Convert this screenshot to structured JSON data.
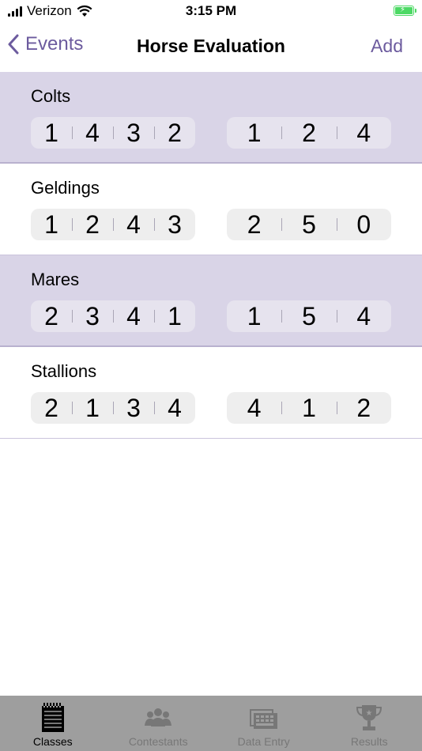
{
  "status_bar": {
    "carrier": "Verizon",
    "time": "3:15 PM"
  },
  "nav": {
    "back_label": "Events",
    "title": "Horse Evaluation",
    "add_label": "Add"
  },
  "classes": [
    {
      "name": "Colts",
      "shaded": true,
      "left": [
        "1",
        "4",
        "3",
        "2"
      ],
      "right": [
        "1",
        "2",
        "4"
      ]
    },
    {
      "name": "Geldings",
      "shaded": false,
      "left": [
        "1",
        "2",
        "4",
        "3"
      ],
      "right": [
        "2",
        "5",
        "0"
      ]
    },
    {
      "name": "Mares",
      "shaded": true,
      "left": [
        "2",
        "3",
        "4",
        "1"
      ],
      "right": [
        "1",
        "5",
        "4"
      ]
    },
    {
      "name": "Stallions",
      "shaded": false,
      "left": [
        "2",
        "1",
        "3",
        "4"
      ],
      "right": [
        "4",
        "1",
        "2"
      ]
    }
  ],
  "tabs": [
    {
      "label": "Classes",
      "icon": "notepad-icon",
      "active": true
    },
    {
      "label": "Contestants",
      "icon": "people-icon",
      "active": false
    },
    {
      "label": "Data Entry",
      "icon": "data-entry-icon",
      "active": false
    },
    {
      "label": "Results",
      "icon": "trophy-icon",
      "active": false
    }
  ],
  "colors": {
    "accent": "#6c5b9e",
    "row_highlight": "#d9d4e7",
    "tab_bar": "#9e9e9e",
    "battery": "#4cd964"
  }
}
